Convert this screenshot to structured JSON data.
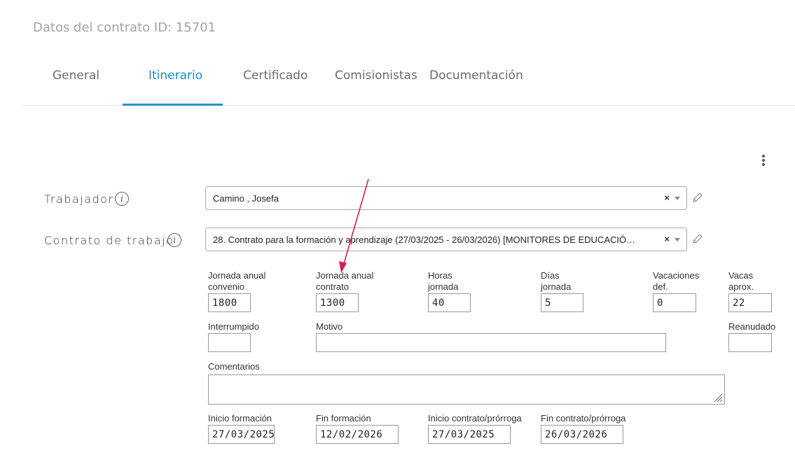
{
  "page": {
    "title": "Datos del contrato ID: 15701"
  },
  "tabs": [
    {
      "label": "General"
    },
    {
      "label": "Itinerario",
      "active": true
    },
    {
      "label": "Certificado"
    },
    {
      "label": "Comisionistas"
    },
    {
      "label": "Documentación"
    }
  ],
  "trabajador": {
    "label": "Trabajador",
    "value": "Camino , Josefa"
  },
  "contrato": {
    "label": "Contrato de trabajo",
    "value": "28. Contrato para la formación y aprendizaje (27/03/2025 - 26/03/2026) [MONITORES DE EDUCACIÓ…"
  },
  "fields": {
    "jornada_convenio": {
      "label1": "Jornada anual",
      "label2": "convenio",
      "value": "1800"
    },
    "jornada_contrato": {
      "label1": "Jornada anual",
      "label2": "contrato",
      "value": "1300"
    },
    "horas_jornada": {
      "label1": "Horas",
      "label2": "jornada",
      "value": "40"
    },
    "dias_jornada": {
      "label1": "Días",
      "label2": "jornada",
      "value": "5"
    },
    "vacaciones_def": {
      "label1": "Vacaciones",
      "label2": "def.",
      "value": "0"
    },
    "vacas_aprox": {
      "label1": "Vacas",
      "label2": "aprox.",
      "value": "22"
    },
    "interrumpido": {
      "label": "Interrumpido",
      "value": ""
    },
    "motivo": {
      "label": "Motivo",
      "value": ""
    },
    "reanudado": {
      "label": "Reanudado",
      "value": ""
    },
    "comentarios": {
      "label": "Comentarios",
      "value": ""
    },
    "inicio_formacion": {
      "label": "Inicio formación",
      "value": "27/03/2025"
    },
    "fin_formacion": {
      "label": "Fin formación",
      "value": "12/02/2026"
    },
    "inicio_contrato": {
      "label": "Inicio contrato/prórroga",
      "value": "27/03/2025"
    },
    "fin_contrato": {
      "label": "Fin contrato/prórroga",
      "value": "26/03/2026"
    }
  },
  "icons": {
    "info": "info-icon",
    "clear": "×",
    "edit": "pencil-icon",
    "menu": "kebab-menu-icon"
  },
  "colors": {
    "accent": "#2b8fce",
    "annotation_arrow": "#d81e4a"
  }
}
